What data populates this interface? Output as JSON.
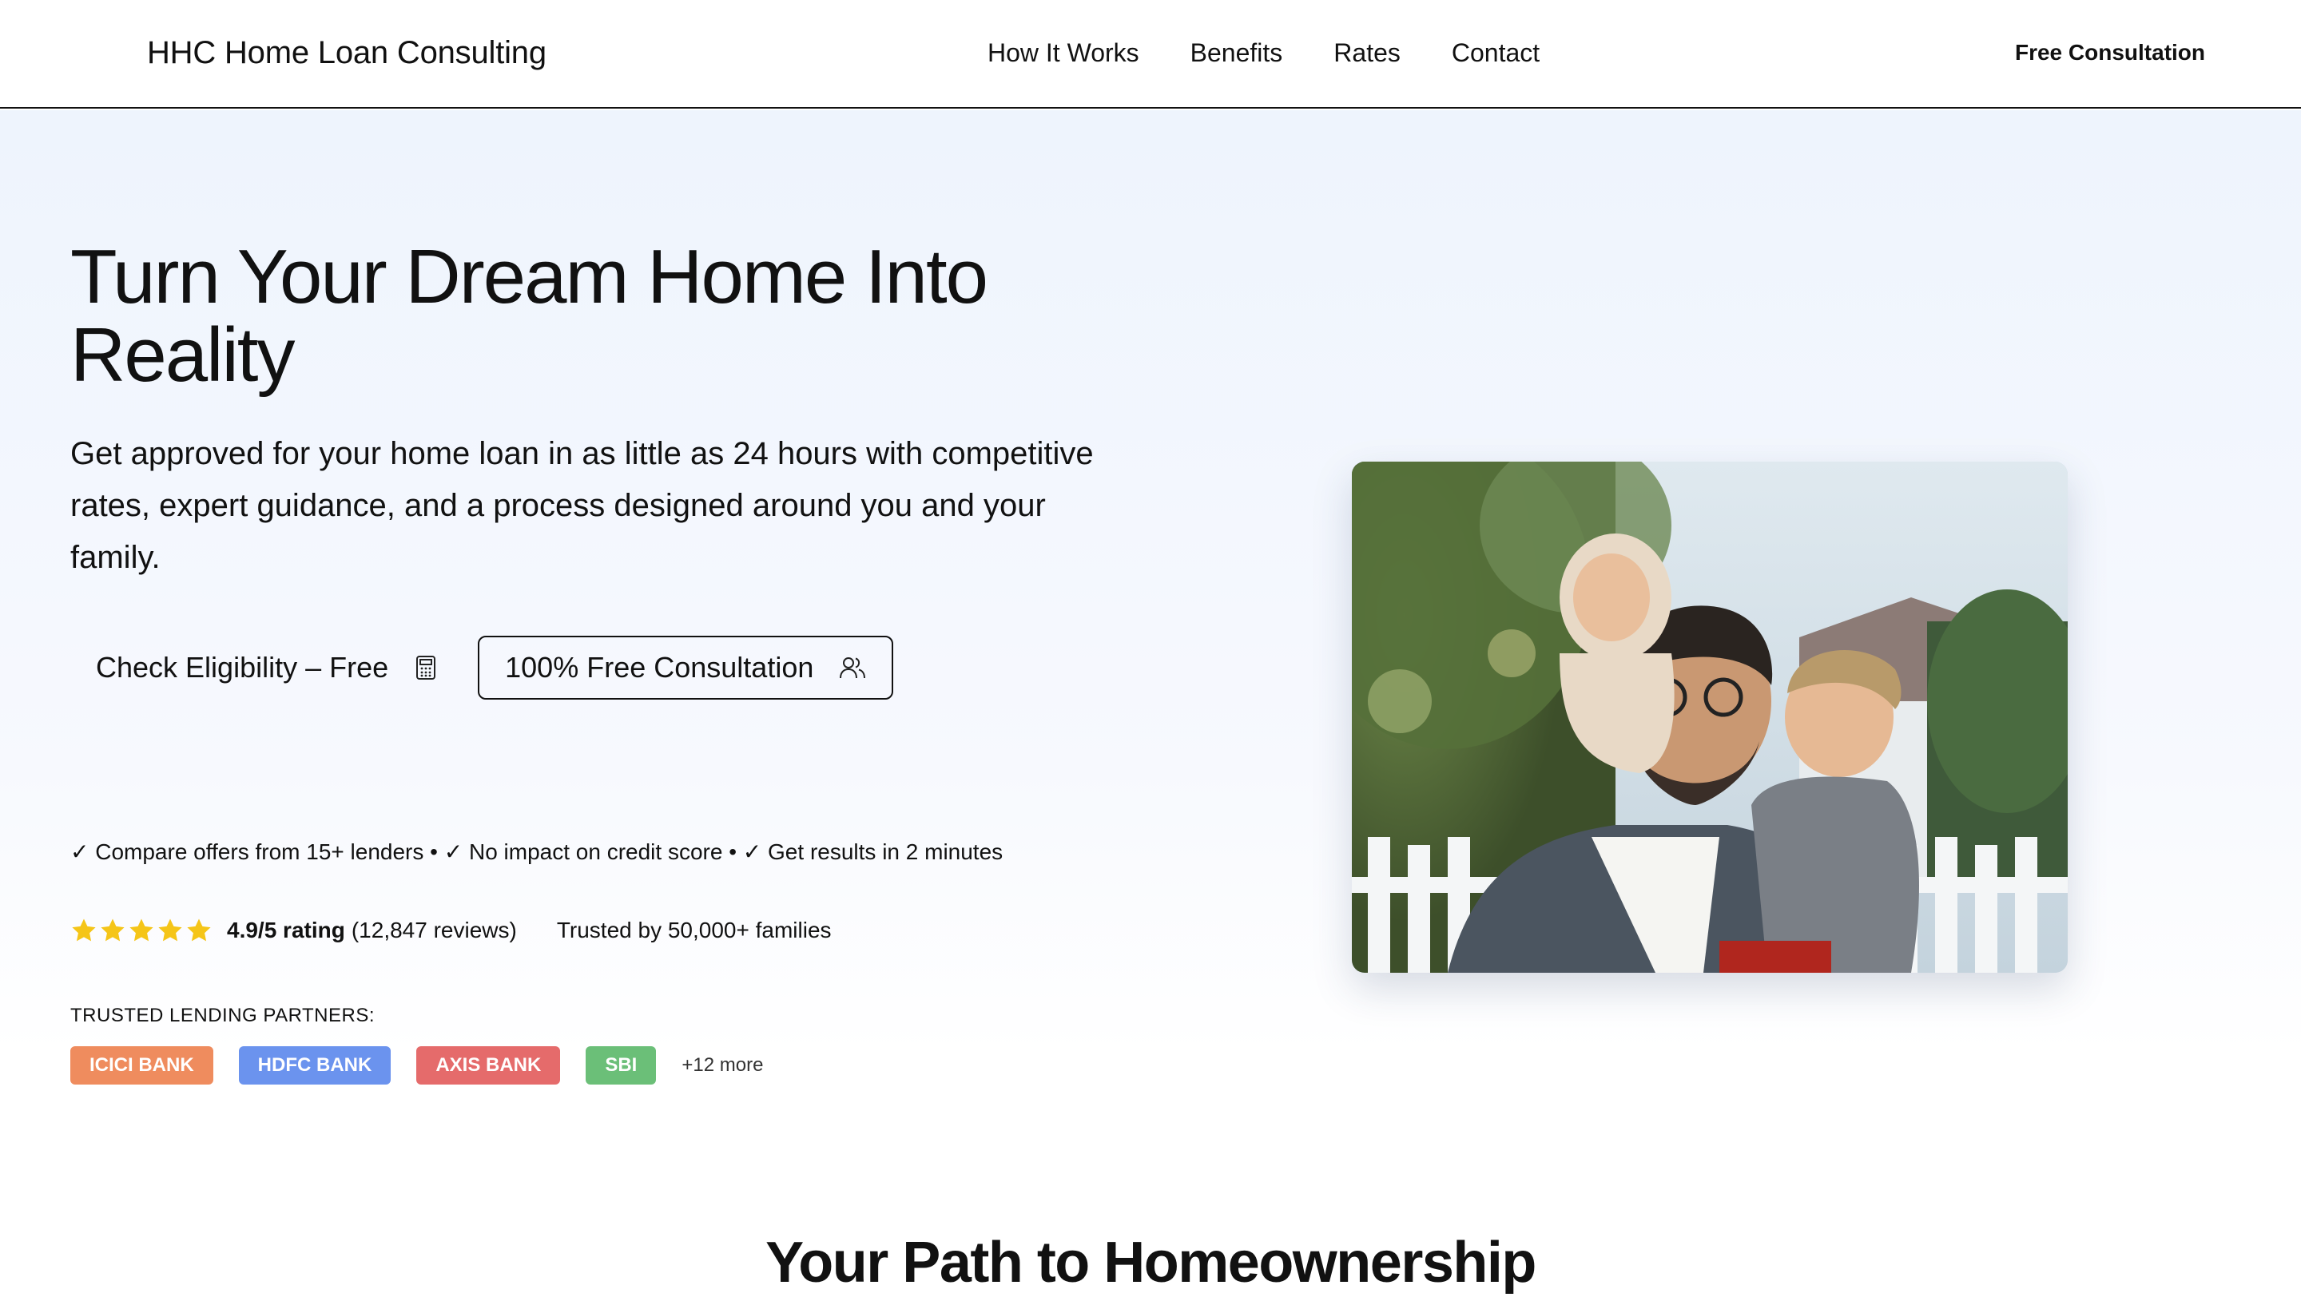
{
  "header": {
    "brand": "HHC Home Loan Consulting",
    "nav": [
      "How It Works",
      "Benefits",
      "Rates",
      "Contact"
    ],
    "cta": "Free Consultation"
  },
  "hero": {
    "title": "Turn Your Dream Home Into Reality",
    "subtitle": "Get approved for your home loan in as little as 24 hours with competitive rates, expert guidance, and a process designed around you and your family.",
    "primary_button": "Check Eligibility – Free",
    "primary_icon": "calculator-icon",
    "secondary_button": "100% Free Consultation",
    "secondary_icon": "users-icon",
    "checks": "✓ Compare offers from 15+ lenders • ✓ No impact on credit score • ✓ Get results in 2 minutes",
    "rating": {
      "stars": 5,
      "star_color": "#F5C518",
      "score": "4.9/5 rating",
      "reviews": "(12,847 reviews)",
      "trusted": "Trusted by 50,000+ families"
    },
    "partners_label": "TRUSTED LENDING PARTNERS:",
    "partners": [
      {
        "name": "ICICI BANK",
        "color": "#EF8C5E"
      },
      {
        "name": "HDFC BANK",
        "color": "#6B93EE"
      },
      {
        "name": "AXIS BANK",
        "color": "#E56B6B"
      },
      {
        "name": "SBI",
        "color": "#6BBF78"
      }
    ],
    "partners_more": "+12 more",
    "image": "family-photo"
  },
  "section": {
    "title": "Your Path to Homeownership"
  }
}
